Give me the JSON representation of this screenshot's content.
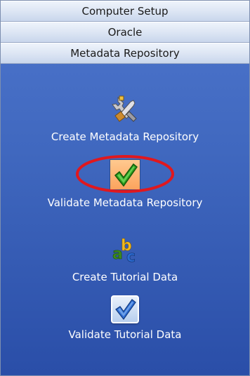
{
  "nav": {
    "computer_setup": "Computer Setup",
    "oracle": "Oracle",
    "metadata_repository": "Metadata Repository"
  },
  "items": [
    {
      "label": "Create Metadata Repository",
      "icon": "tools-icon"
    },
    {
      "label": "Validate Metadata Repository",
      "icon": "checkmark-icon",
      "selected": true
    },
    {
      "label": "Create Tutorial Data",
      "icon": "abc-icon"
    },
    {
      "label": "Validate Tutorial Data",
      "icon": "check-box-icon"
    }
  ],
  "colors": {
    "panel_top": "#4d75cc",
    "panel_bottom": "#2a4ea8",
    "selected_tile": "#fca35d",
    "annotation_ring": "#e0181e"
  }
}
